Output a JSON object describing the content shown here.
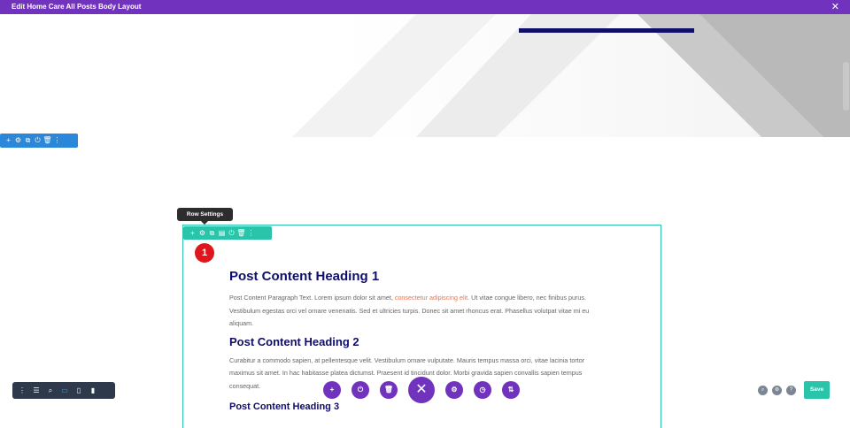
{
  "topbar": {
    "title": "Edit Home Care All Posts Body Layout",
    "close_glyph": "✕"
  },
  "colors": {
    "builder_purple": "#7133bd",
    "section_blue": "#2b87da",
    "row_teal": "#29c4a9",
    "heading_navy": "#0f0e6b",
    "link_orange": "#e8744f",
    "badge_red": "#e0161e"
  },
  "section_toolbar": {
    "icons": [
      "plus-icon",
      "gear-icon",
      "duplicate-icon",
      "power-icon",
      "trash-icon",
      "more-icon"
    ],
    "glyphs": [
      "+",
      "⚙",
      "⧉",
      "⏻",
      "🗑",
      "⋮"
    ]
  },
  "row_tooltip": "Row Settings",
  "row_toolbar": {
    "icons": [
      "plus-icon",
      "gear-icon",
      "duplicate-icon",
      "columns-icon",
      "power-icon",
      "trash-icon",
      "more-icon"
    ],
    "glyphs": [
      "+",
      "⚙",
      "⧉",
      "▤",
      "⏻",
      "🗑",
      "⋮"
    ]
  },
  "badge": "1",
  "content": {
    "heading1": "Post Content Heading 1",
    "para1_start": "Post Content Paragraph Text. Lorem ipsum dolor sit amet, ",
    "para1_link": "consectetur adipiscing elit",
    "para1_end": ". Ut vitae congue libero, nec finibus purus. Vestibulum egestas orci vel ornare venenatis. Sed et ultricies turpis. Donec sit amet rhoncus erat. Phasellus volutpat vitae mi eu aliquam.",
    "heading2": "Post Content Heading 2",
    "para2": "Curabitur a commodo sapien, at pellentesque velit. Vestibulum ornare vulputate. Mauris tempus massa orci, vitae lacinia tortor maximus sit amet. In hac habitasse platea dictumst. Praesent id tincidunt dolor. Morbi gravida sapien convallis sapien tempus consequat.",
    "heading3": "Post Content Heading 3"
  },
  "bottom_left_toolbar": {
    "icons": [
      "menu-dots-icon",
      "wireframe-icon",
      "zoom-icon",
      "desktop-icon",
      "tablet-icon",
      "phone-icon"
    ],
    "glyphs": [
      "⋮",
      "☰",
      "⌕",
      "▭",
      "▯",
      "▮"
    ]
  },
  "bottom_center_fabs": {
    "icons": [
      "add-icon",
      "power-icon",
      "trash-icon",
      "close-icon",
      "gear-icon",
      "history-icon",
      "sort-icon"
    ],
    "glyphs": [
      "+",
      "⏻",
      "🗑",
      "✕",
      "⚙",
      "◷",
      "⇅"
    ]
  },
  "bottom_right": {
    "icons": [
      "search-icon",
      "portability-icon",
      "help-icon"
    ],
    "glyphs": [
      "⌕",
      "⊛",
      "?"
    ],
    "save_label": "Save"
  }
}
